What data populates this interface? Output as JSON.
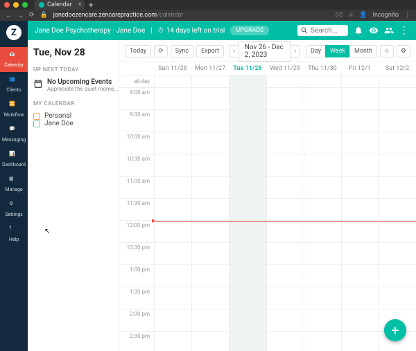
{
  "browser": {
    "tab_title": "Calendar",
    "url_domain": "janedoezencare.zencarepractice.com",
    "url_path": "/calendar",
    "incognito": "Incognito"
  },
  "topbar": {
    "practice": "Jane Doe Psychotherapy · Jane Doe",
    "trial": "14 days left on trial",
    "upgrade": "UPGRADE",
    "search_placeholder": "Search..."
  },
  "leftnav": {
    "items": [
      "Calendar",
      "Clients",
      "Workflow",
      "Messaging",
      "Dashboard",
      "Manage",
      "Settings",
      "Help"
    ]
  },
  "side": {
    "date_heading": "Tue, Nov 28",
    "upnext_label": "UP NEXT TODAY",
    "upcoming_title": "No Upcoming Events",
    "upcoming_sub": "Appreciate the quiet mome...",
    "mycal_label": "MY CALENDAR",
    "calendars": [
      {
        "name": "Personal",
        "color": "#f0a05a"
      },
      {
        "name": "Jane Doe",
        "color": "#7cc28a"
      }
    ]
  },
  "toolbar": {
    "today": "Today",
    "sync": "Sync",
    "export": "Export",
    "range": "Nov 26 - Dec 2, 2023",
    "views": {
      "day": "Day",
      "week": "Week",
      "month": "Month"
    }
  },
  "days": [
    {
      "label": "Sun 11/26",
      "today": false
    },
    {
      "label": "Mon 11/27",
      "today": false
    },
    {
      "label": "Tue 11/28",
      "today": true
    },
    {
      "label": "Wed 11/29",
      "today": false
    },
    {
      "label": "Thu 11/30",
      "today": false
    },
    {
      "label": "Fri 12/1",
      "today": false
    },
    {
      "label": "Sat 12/2",
      "today": false
    }
  ],
  "allday_label": "all-day",
  "times": [
    "9:00 am",
    "9:30 am",
    "10:00 am",
    "10:30 am",
    "11:00 am",
    "11:30 am",
    "12:00 pm",
    "12:30 pm",
    "1:00 pm",
    "1:30 pm",
    "2:00 pm",
    "2:30 pm"
  ],
  "now_row_index": 6
}
